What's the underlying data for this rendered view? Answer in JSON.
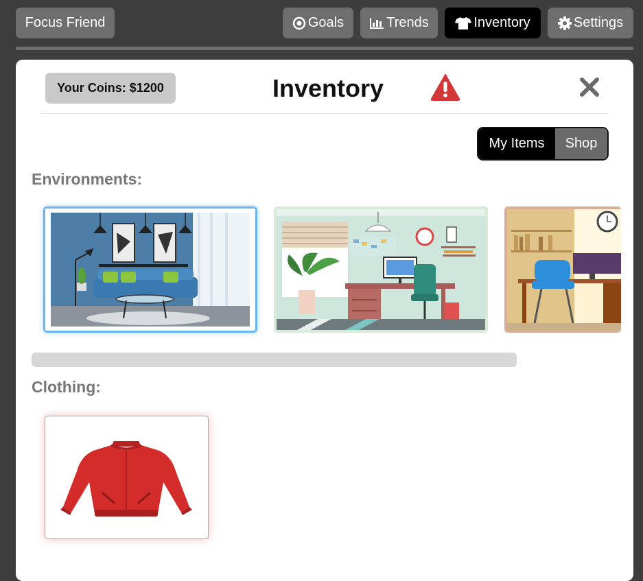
{
  "nav": {
    "brand": "Focus Friend",
    "goals": "Goals",
    "trends": "Trends",
    "inventory": "Inventory",
    "settings": "Settings"
  },
  "modal": {
    "coins": "Your Coins: $1200",
    "title": "Inventory",
    "toggle": {
      "my_items": "My Items",
      "shop": "Shop",
      "selected": "My Items"
    },
    "sections": {
      "environments": "Environments:",
      "clothing": "Clothing:"
    }
  },
  "icons": {
    "goals": "target-icon",
    "trends": "bar-chart-icon",
    "inventory": "shirt-icon",
    "settings": "gear-icon",
    "warning": "warning-icon",
    "close": "close-icon"
  },
  "colors": {
    "active_nav": "#000000",
    "nav": "#6e6e6e",
    "warning": "#d23838",
    "selected_border": "#6ab4f0",
    "jacket": "#d42b2b"
  }
}
